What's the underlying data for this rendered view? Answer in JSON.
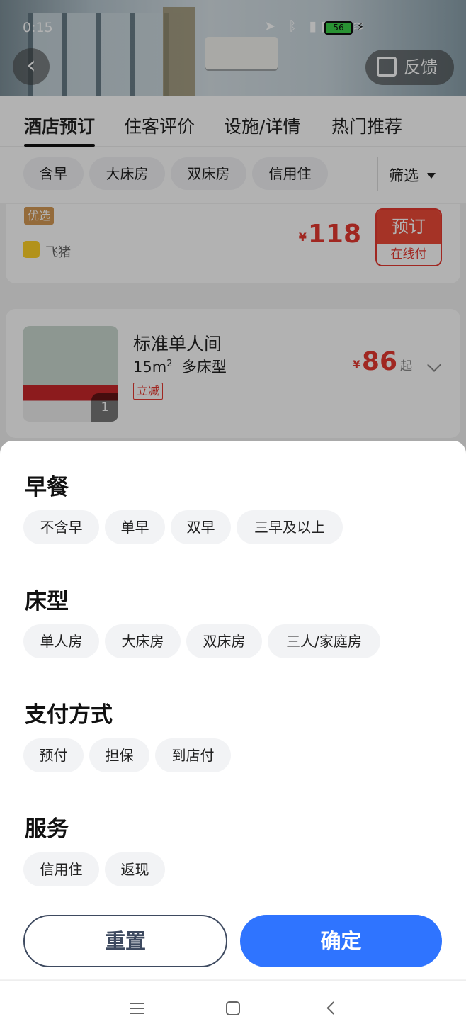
{
  "status_bar": {
    "time": "0:15",
    "icons": "➤ ᛒ ▮▮▮ ≋",
    "battery": "56",
    "charging_symbol": "⚡"
  },
  "header": {
    "back_symbol": "‹",
    "feedback_label": "反馈"
  },
  "tabs": [
    {
      "label": "酒店预订",
      "active": true
    },
    {
      "label": "住客评价",
      "active": false
    },
    {
      "label": "设施/详情",
      "active": false
    },
    {
      "label": "热门推荐",
      "active": false
    }
  ],
  "quick_filters": [
    "含早",
    "大床房",
    "双床房",
    "信用住"
  ],
  "filter_button_label": "筛选",
  "offer_card": {
    "tag": "优选",
    "vendor": "飞猪",
    "currency": "¥",
    "price": "118",
    "book_label": "预订",
    "pay_label": "在线付"
  },
  "room_card": {
    "photo_count": "1",
    "name": "标准单人间",
    "size_text": "15m",
    "size_sup": "2",
    "bed_text": "多床型",
    "promo_tag": "立减",
    "currency": "¥",
    "price": "86",
    "price_suffix": "起"
  },
  "filter_sheet": {
    "sections": [
      {
        "title": "早餐",
        "options": [
          "不含早",
          "单早",
          "双早",
          "三早及以上"
        ]
      },
      {
        "title": "床型",
        "options": [
          "单人房",
          "大床房",
          "双床房",
          "三人/家庭房"
        ]
      },
      {
        "title": "支付方式",
        "options": [
          "预付",
          "担保",
          "到店付"
        ]
      },
      {
        "title": "服务",
        "options": [
          "信用住",
          "返现"
        ]
      }
    ],
    "reset_label": "重置",
    "confirm_label": "确定"
  },
  "colors": {
    "accent_blue": "#2f74ff",
    "price_red": "#e63930",
    "reset_border": "#3e4a60"
  },
  "icons": [
    "back-icon",
    "edit-icon",
    "filter-caret-icon",
    "expand-chevron-icon",
    "nav-menu-icon",
    "nav-home-icon",
    "nav-back-icon"
  ]
}
